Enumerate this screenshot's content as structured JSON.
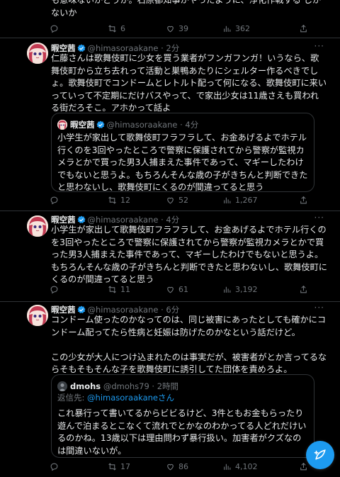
{
  "top_partial": {
    "text": "も意味ないかどうか。石原都知事がやったように、浄化作戦する しかないか",
    "stats": {
      "replies": "",
      "retweets": "6",
      "likes": "39",
      "views": "362"
    }
  },
  "tweets": [
    {
      "name": "暇空茜",
      "handle": "@himasoraakane",
      "time": "· 2分",
      "text": "仁藤さんは歌舞伎町に少女を買う業者がフンガフンガ！いうなら、歌舞伎町から立ち去れって活動と巣鴨あたりにシェルター作るべきでしょ。歌舞伎町でコンドームとレトルト配って何になる、歌舞伎町に来いっていって不定期にだけバスやって、で家出少女は11歳さえも買われる街だろそこ。アホかって話よ",
      "quote": {
        "name": "暇空茜",
        "handle": "@himasoraakane",
        "time": "· 4分",
        "text": "小学生が家出して歌舞伎町フラフラして、お金あげるよでホテル行くのを3回やったところで警察に保護されてから警察が監視カメラとかで買った男3人捕まえた事件であって、マギーしたわけでもないと思うよ。もちろんそんな歳の子がきちんと判断できたと思わないし、歌舞伎町にくるのが間違ってると思う"
      },
      "stats": {
        "replies": "",
        "retweets": "12",
        "likes": "52",
        "views": "1,267"
      }
    },
    {
      "name": "暇空茜",
      "handle": "@himasoraakane",
      "time": "· 4分",
      "text": "小学生が家出して歌舞伎町フラフラして、お金あげるよでホテル行くのを3回やったところで警察に保護されてから警察が監視カメラとかで買った男3人捕まえた事件であって、マギーしたわけでもないと思うよ。もちろんそんな歳の子がきちんと判断できたと思わないし、歌舞伎町にくるのが間違ってると思う",
      "stats": {
        "replies": "",
        "retweets": "11",
        "likes": "61",
        "views": "3,192"
      }
    },
    {
      "name": "暇空茜",
      "handle": "@himasoraakane",
      "time": "· 6分",
      "text": "コンドーム使ったのかなってのは、同じ被害にあったとしても確かにコンドーム配ってたら性病と妊娠は防げたのかなという話だけど。\n\nこの少女が大人につけ込まれたのは事実だが、被害者がとか言ってるならそもそもそんな子を歌舞伎町に誘引してた団体を責めろよ。",
      "quote": {
        "name": "dmohs",
        "handle": "@dmohs79",
        "time": "· 2時間",
        "reply_prefix": "返信先: ",
        "reply_mention": "@himasoraakaneさん",
        "text": "これ暴行って書いてるからビビるけど、3件ともお金もらったり遊んで泊まるとこなくて流れでとかなのわかってる人どれだけいるのかね。13歳以下は理由問わず暴行扱い。加害者がクズなのは間違いないが。"
      },
      "stats": {
        "replies": "",
        "retweets": "17",
        "likes": "86",
        "views": "4,102"
      }
    }
  ],
  "icons": {
    "reply": "reply-icon",
    "retweet": "retweet-icon",
    "like": "heart-icon",
    "views": "views-icon",
    "share": "share-icon",
    "compose": "compose-icon"
  },
  "colors": {
    "accent": "#1d9bf0",
    "verified": "#1d9bf0",
    "muted": "#71767b"
  }
}
